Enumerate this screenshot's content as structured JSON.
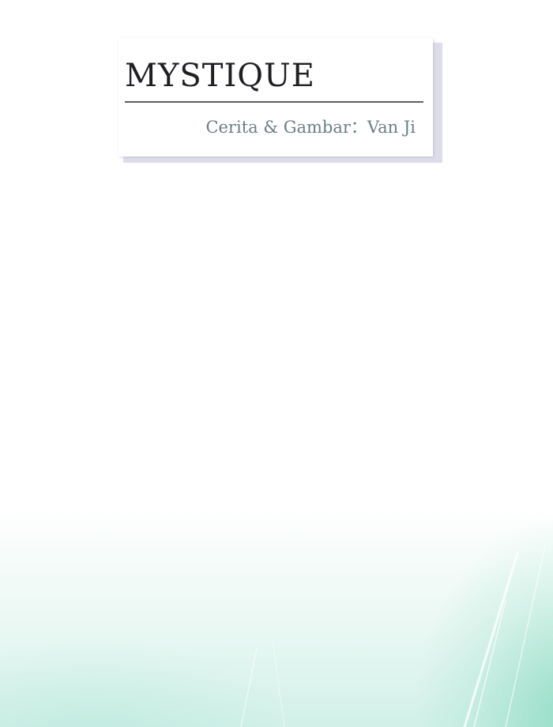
{
  "title_card": {
    "title": "MYSTIQUE",
    "credit": "Cerita & Gambar：Van Ji"
  },
  "colors": {
    "title": "#1f1f23",
    "credit": "#6a7f80",
    "rule": "#5e5e64",
    "card_shadow": "#dcdcea",
    "wash": "#8fdcc4"
  }
}
